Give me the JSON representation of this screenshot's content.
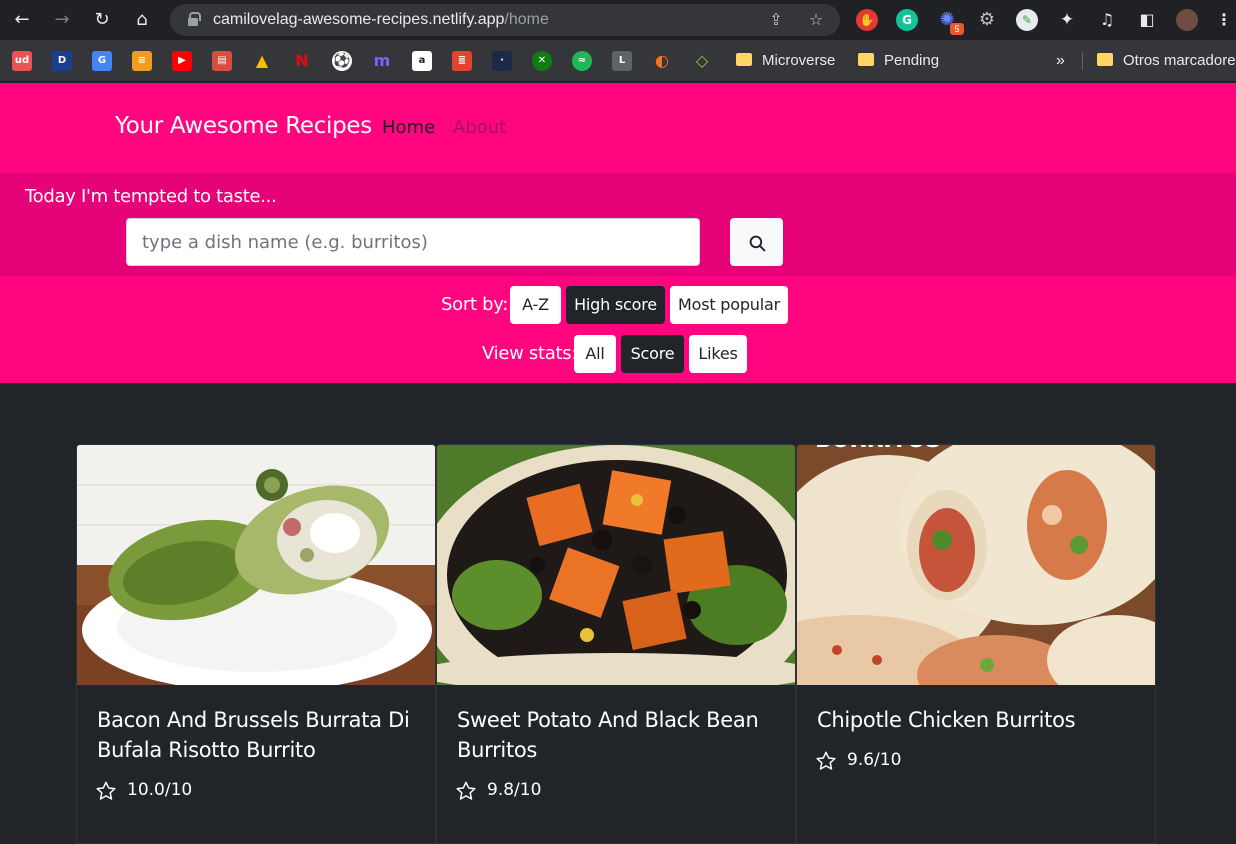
{
  "browser": {
    "url_host": "camilovelag-awesome-recipes.netlify.app",
    "url_path": "/home",
    "extension_badge": "5",
    "bookmarks": {
      "folders": [
        "Microverse",
        "Pending"
      ],
      "overflow": "»",
      "other": "Otros marcadores"
    }
  },
  "header": {
    "brand": "Your Awesome Recipes",
    "nav": {
      "home": "Home",
      "about": "About"
    }
  },
  "search": {
    "prompt": "Today I'm tempted to taste...",
    "placeholder": "type a dish name (e.g. burritos)",
    "value": ""
  },
  "sort": {
    "label": "Sort by:",
    "options": [
      "A-Z",
      "High score",
      "Most popular"
    ],
    "selected": "High score"
  },
  "stats": {
    "label": "View stats:",
    "options": [
      "All",
      "Score",
      "Likes"
    ],
    "selected": "Score"
  },
  "recipes": [
    {
      "title": "Bacon And Brussels Burrata Di Bufala Risotto Burrito",
      "score": "10.0/10"
    },
    {
      "title": "Sweet Potato And Black Bean Burritos",
      "score": "9.8/10"
    },
    {
      "title": "Chipotle Chicken Burritos",
      "score": "9.6/10"
    }
  ],
  "image_text": {
    "card3": "BURRITOS"
  },
  "colors": {
    "brand_pink": "#ff0580",
    "search_band": "#e6037a",
    "page_bg": "#212529"
  }
}
